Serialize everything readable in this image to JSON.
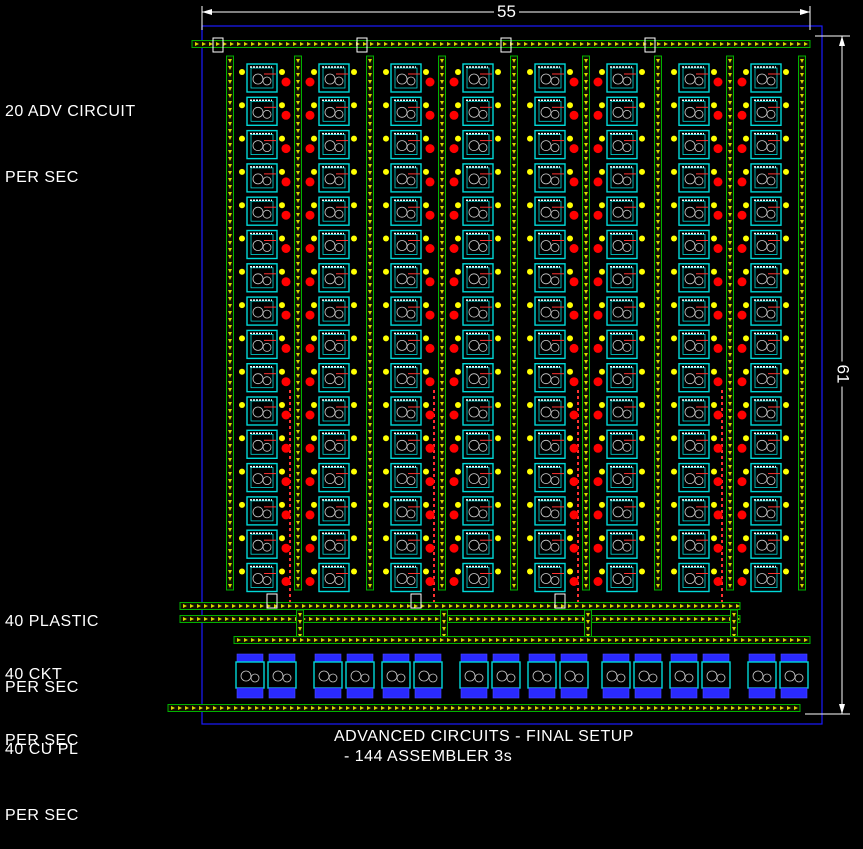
{
  "labels": {
    "adv_circuit_1": "20 ADV CIRCUIT",
    "adv_circuit_2": "PER SEC",
    "plastic_1": "40 PLASTIC",
    "plastic_2": "PER SEC",
    "ckt_1": "40 CKT",
    "ckt_2": "PER SEC",
    "cu_1": "40 CU PL",
    "cu_2": "PER SEC"
  },
  "dimensions": {
    "width": "55",
    "height": "61"
  },
  "caption": {
    "line1": "ADVANCED CIRCUITS - FINAL SETUP",
    "line2": "- 144 ASSEMBLER 3s"
  },
  "colors": {
    "background": "#000000",
    "frame": "#1a1aff",
    "belt": "#d8d800",
    "belt_green": "#00b000",
    "belt_arrow": "#d8d800",
    "assembler": "#00d8d8",
    "inserter": "#ffff00",
    "pole": "#ff0000",
    "chest": "#2a2aff",
    "dim_line": "#ffffff"
  },
  "grid": {
    "columns": 8,
    "rows": 16,
    "lower_assemblers": 16
  }
}
